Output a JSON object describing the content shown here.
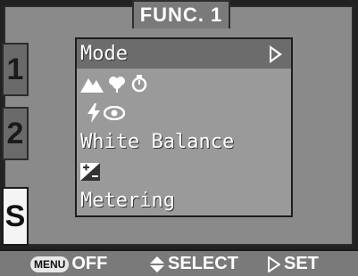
{
  "header": {
    "title": "FUNC. 1"
  },
  "side_tabs": [
    {
      "label": "1"
    },
    {
      "label": "2"
    },
    {
      "label": "S"
    }
  ],
  "menu": {
    "items": [
      {
        "label": "Mode",
        "icon": "none",
        "selected": true,
        "has_submenu": true
      },
      {
        "label": "",
        "icon": "landscape-macro-selftimer-icons"
      },
      {
        "label": "",
        "icon": "flash-redeye-icons"
      },
      {
        "label": "White Balance",
        "icon": "none"
      },
      {
        "label": "",
        "icon": "exposure-compensation-icon"
      },
      {
        "label": "Metering",
        "icon": "none"
      }
    ]
  },
  "footer": {
    "menu_badge": "MENU",
    "off_label": "OFF",
    "select_label": "SELECT",
    "set_label": "SET"
  },
  "colors": {
    "frame": "#8a8a8a",
    "panel": "#9a9a9a",
    "selected_row": "#6c6c6c",
    "text": "#ffffff"
  }
}
